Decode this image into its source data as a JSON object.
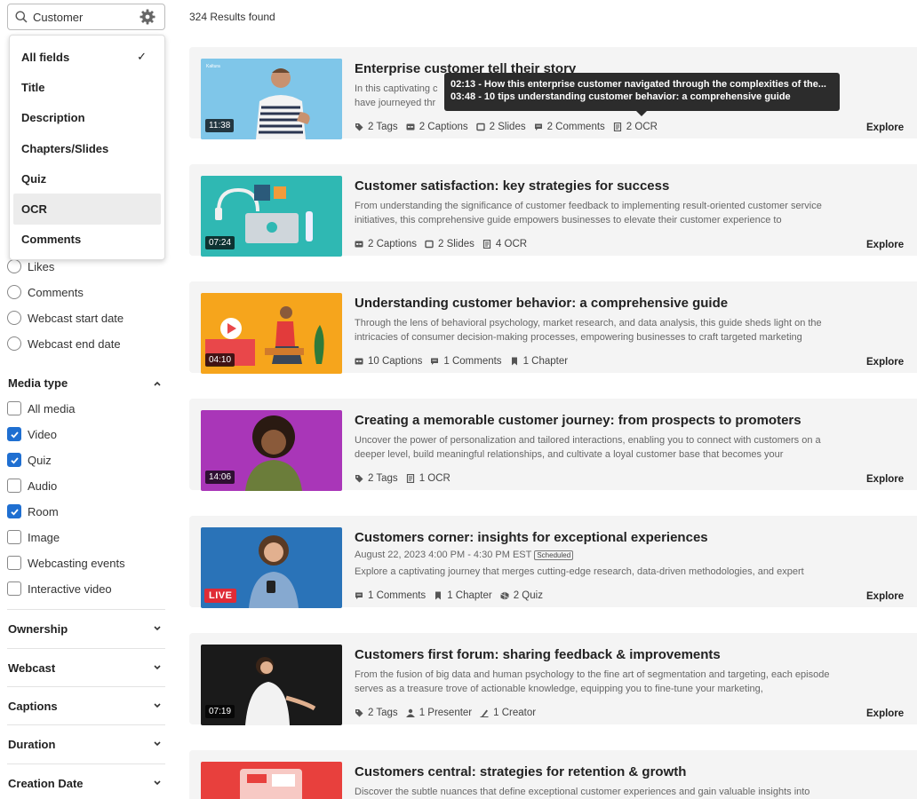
{
  "search": {
    "value": "Customer",
    "placeholder": "Search"
  },
  "dropdown": {
    "items": [
      {
        "label": "All fields",
        "selected": true
      },
      {
        "label": "Title"
      },
      {
        "label": "Description"
      },
      {
        "label": "Chapters/Slides"
      },
      {
        "label": "Quiz"
      },
      {
        "label": "OCR",
        "highlighted": true
      },
      {
        "label": "Comments"
      }
    ]
  },
  "sort_options": [
    "Likes",
    "Comments",
    "Webcast start date",
    "Webcast end date"
  ],
  "media_type": {
    "title": "Media type",
    "options": [
      {
        "label": "All media",
        "checked": false
      },
      {
        "label": "Video",
        "checked": true
      },
      {
        "label": "Quiz",
        "checked": true
      },
      {
        "label": "Audio",
        "checked": false
      },
      {
        "label": "Room",
        "checked": true
      },
      {
        "label": "Image",
        "checked": false
      },
      {
        "label": "Webcasting events",
        "checked": false
      },
      {
        "label": "Interactive video",
        "checked": false
      }
    ]
  },
  "filters": [
    "Ownership",
    "Webcast",
    "Captions",
    "Duration",
    "Creation Date"
  ],
  "results": {
    "count": "324 Results found",
    "explore_label": "Explore",
    "items": [
      {
        "title": "Enterprise customer tell their story",
        "desc": "In this captivating c                                                                                                  e have journeyed thr",
        "desc_line1": "In this captivating c",
        "desc_line2": "have journeyed thr",
        "duration": "11:38",
        "meta": [
          "2 Tags",
          "2 Captions",
          "2 Slides",
          "2 Comments",
          "2 OCR"
        ]
      },
      {
        "title": "Customer satisfaction: key strategies for success",
        "desc": "From understanding the significance of customer feedback to implementing result-oriented customer service initiatives, this comprehensive guide empowers businesses to elevate their customer experience to",
        "duration": "07:24",
        "meta": [
          "2 Captions",
          "2 Slides",
          "4 OCR"
        ]
      },
      {
        "title": "Understanding customer behavior: a comprehensive guide",
        "desc": "Through the lens of behavioral psychology, market research, and data analysis, this guide sheds light on the intricacies of consumer decision-making processes, empowering businesses to craft targeted marketing",
        "duration": "04:10",
        "meta": [
          "10 Captions",
          "1 Comments",
          "1 Chapter"
        ]
      },
      {
        "title": "Creating a memorable customer journey: from prospects to promoters",
        "desc": "Uncover the power of personalization and tailored interactions, enabling you to connect with customers on a deeper level, build meaningful relationships, and cultivate a loyal customer base that becomes your",
        "duration": "14:06",
        "meta": [
          "2 Tags",
          "1 OCR"
        ]
      },
      {
        "title": "Customers corner: insights for exceptional experiences",
        "date": "August 22, 2023 4:00 PM - 4:30 PM EST",
        "badge": "Scheduled",
        "desc": "Explore a captivating journey that merges cutting-edge research, data-driven methodologies, and expert",
        "live": "LIVE",
        "meta": [
          "1 Comments",
          "1 Chapter",
          "2 Quiz"
        ]
      },
      {
        "title": "Customers first forum: sharing feedback & improvements",
        "desc": "From the fusion of big data and human psychology to the fine art of segmentation and targeting, each episode serves as a treasure trove of actionable knowledge, equipping you to fine-tune your marketing,",
        "duration": "07:19",
        "meta": [
          "2 Tags",
          "1 Presenter",
          "1 Creator"
        ]
      },
      {
        "title": "Customers central: strategies for retention & growth",
        "desc": "Discover the subtle nuances that define exceptional customer experiences and gain valuable insights into"
      }
    ]
  },
  "tooltip": {
    "lines": [
      "02:13 - How this enterprise customer navigated through the complexities of the...",
      "03:48 - 10 tips understanding customer behavior: a comprehensive guide"
    ]
  },
  "colors": {
    "accent": "#1f6fd1",
    "live": "#e02b36",
    "card_bg": "#f4f4f4"
  }
}
